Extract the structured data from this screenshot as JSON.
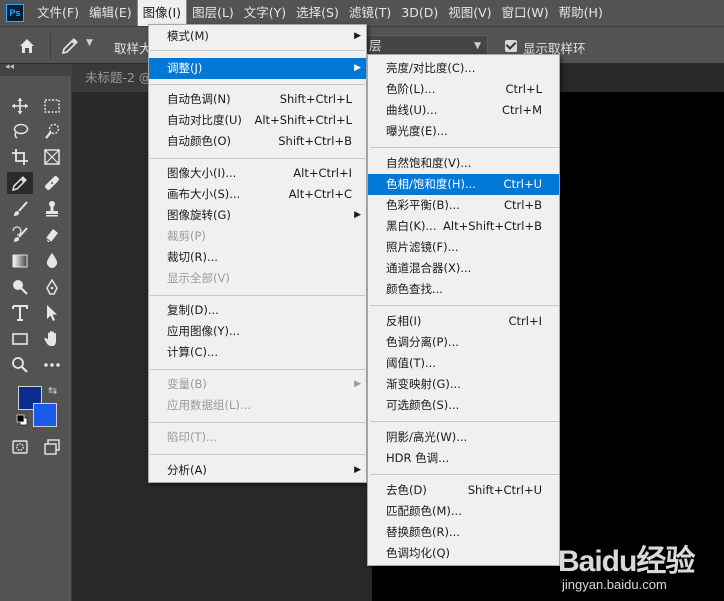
{
  "app": {
    "logo_text": "Ps"
  },
  "menubar": {
    "items": [
      "文件(F)",
      "编辑(E)",
      "图像(I)",
      "图层(L)",
      "文字(Y)",
      "选择(S)",
      "滤镜(T)",
      "3D(D)",
      "视图(V)",
      "窗口(W)",
      "帮助(H)"
    ],
    "active": "图像(I)"
  },
  "options_bar": {
    "sample_label": "取样大",
    "layer_dropdown_value": "层",
    "show_ring_label": "显示取样环",
    "show_ring_checked": true
  },
  "document": {
    "tab_title": "未标题-2 @"
  },
  "colors": {
    "foreground": "#0b2c8a",
    "background": "#1a5ae8",
    "highlight": "#0078d7"
  },
  "image_menu": {
    "items": [
      {
        "label": "模式(M)",
        "shortcut": "",
        "submenu": true,
        "disabled": false
      },
      {
        "label": "调整(J)",
        "shortcut": "",
        "submenu": true,
        "disabled": false,
        "highlighted": true
      },
      {
        "label": "自动色调(N)",
        "shortcut": "Shift+Ctrl+L",
        "submenu": false,
        "disabled": false
      },
      {
        "label": "自动对比度(U)",
        "shortcut": "Alt+Shift+Ctrl+L",
        "submenu": false,
        "disabled": false
      },
      {
        "label": "自动颜色(O)",
        "shortcut": "Shift+Ctrl+B",
        "submenu": false,
        "disabled": false
      },
      {
        "label": "图像大小(I)...",
        "shortcut": "Alt+Ctrl+I",
        "submenu": false,
        "disabled": false
      },
      {
        "label": "画布大小(S)...",
        "shortcut": "Alt+Ctrl+C",
        "submenu": false,
        "disabled": false
      },
      {
        "label": "图像旋转(G)",
        "shortcut": "",
        "submenu": true,
        "disabled": false
      },
      {
        "label": "裁剪(P)",
        "shortcut": "",
        "submenu": false,
        "disabled": true
      },
      {
        "label": "裁切(R)...",
        "shortcut": "",
        "submenu": false,
        "disabled": false
      },
      {
        "label": "显示全部(V)",
        "shortcut": "",
        "submenu": false,
        "disabled": true
      },
      {
        "label": "复制(D)...",
        "shortcut": "",
        "submenu": false,
        "disabled": false
      },
      {
        "label": "应用图像(Y)...",
        "shortcut": "",
        "submenu": false,
        "disabled": false
      },
      {
        "label": "计算(C)...",
        "shortcut": "",
        "submenu": false,
        "disabled": false
      },
      {
        "label": "变量(B)",
        "shortcut": "",
        "submenu": true,
        "disabled": true
      },
      {
        "label": "应用数据组(L)...",
        "shortcut": "",
        "submenu": false,
        "disabled": true
      },
      {
        "label": "陷印(T)...",
        "shortcut": "",
        "submenu": false,
        "disabled": true
      },
      {
        "label": "分析(A)",
        "shortcut": "",
        "submenu": true,
        "disabled": false
      }
    ]
  },
  "adjust_menu": {
    "items": [
      {
        "label": "亮度/对比度(C)...",
        "shortcut": ""
      },
      {
        "label": "色阶(L)...",
        "shortcut": "Ctrl+L"
      },
      {
        "label": "曲线(U)...",
        "shortcut": "Ctrl+M"
      },
      {
        "label": "曝光度(E)...",
        "shortcut": ""
      },
      {
        "label": "自然饱和度(V)...",
        "shortcut": ""
      },
      {
        "label": "色相/饱和度(H)...",
        "shortcut": "Ctrl+U",
        "highlighted": true
      },
      {
        "label": "色彩平衡(B)...",
        "shortcut": "Ctrl+B"
      },
      {
        "label": "黑白(K)...",
        "shortcut": "Alt+Shift+Ctrl+B"
      },
      {
        "label": "照片滤镜(F)...",
        "shortcut": ""
      },
      {
        "label": "通道混合器(X)...",
        "shortcut": ""
      },
      {
        "label": "颜色查找...",
        "shortcut": ""
      },
      {
        "label": "反相(I)",
        "shortcut": "Ctrl+I"
      },
      {
        "label": "色调分离(P)...",
        "shortcut": ""
      },
      {
        "label": "阈值(T)...",
        "shortcut": ""
      },
      {
        "label": "渐变映射(G)...",
        "shortcut": ""
      },
      {
        "label": "可选颜色(S)...",
        "shortcut": ""
      },
      {
        "label": "阴影/高光(W)...",
        "shortcut": ""
      },
      {
        "label": "HDR 色调...",
        "shortcut": ""
      },
      {
        "label": "去色(D)",
        "shortcut": "Shift+Ctrl+U"
      },
      {
        "label": "匹配颜色(M)...",
        "shortcut": ""
      },
      {
        "label": "替换颜色(R)...",
        "shortcut": ""
      },
      {
        "label": "色调均化(Q)",
        "shortcut": ""
      }
    ]
  },
  "watermark": {
    "brand": "Baidu经验",
    "url": "jingyan.baidu.com"
  }
}
